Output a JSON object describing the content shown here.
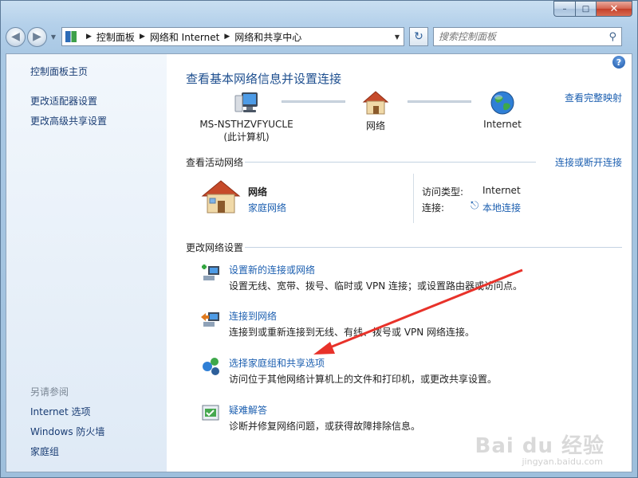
{
  "window": {
    "caption_buttons": {
      "minimize": "–",
      "maximize": "□",
      "close": "✕"
    }
  },
  "nav": {
    "back_icon": "back-arrow-icon",
    "forward_icon": "forward-arrow-icon",
    "breadcrumbs": [
      "控制面板",
      "网络和 Internet",
      "网络和共享中心"
    ],
    "search_placeholder": "搜索控制面板"
  },
  "sidebar": {
    "items": [
      {
        "label": "控制面板主页"
      },
      {
        "label": "更改适配器设置"
      },
      {
        "label": "更改高级共享设置"
      }
    ],
    "see_also_heading": "另请参阅",
    "see_also": [
      {
        "label": "Internet 选项"
      },
      {
        "label": "Windows 防火墙"
      },
      {
        "label": "家庭组"
      }
    ]
  },
  "main": {
    "title": "查看基本网络信息并设置连接",
    "full_map_link": "查看完整映射",
    "map": {
      "computer_name": "MS-NSTHZVFYUCLE",
      "computer_sub": "(此计算机)",
      "network_label": "网络",
      "internet_label": "Internet"
    },
    "active_networks": {
      "heading": "查看活动网络",
      "connect_link": "连接或断开连接",
      "network_name": "网络",
      "network_type_link": "家庭网络",
      "access_type_label": "访问类型:",
      "access_type_value": "Internet",
      "connections_label": "连接:",
      "connection_link": "本地连接"
    },
    "change_settings": {
      "heading": "更改网络设置",
      "options": [
        {
          "title": "设置新的连接或网络",
          "desc": "设置无线、宽带、拨号、临时或 VPN 连接；或设置路由器或访问点。",
          "icon": "new-connection-icon"
        },
        {
          "title": "连接到网络",
          "desc": "连接到或重新连接到无线、有线、拨号或 VPN 网络连接。",
          "icon": "connect-network-icon"
        },
        {
          "title": "选择家庭组和共享选项",
          "desc": "访问位于其他网络计算机上的文件和打印机，或更改共享设置。",
          "icon": "homegroup-icon"
        },
        {
          "title": "疑难解答",
          "desc": "诊断并修复网络问题，或获得故障排除信息。",
          "icon": "troubleshoot-icon"
        }
      ]
    }
  },
  "watermark": {
    "text": "Bai du 经验",
    "sub": "jingyan.baidu.com"
  },
  "colors": {
    "link": "#1c5fb0",
    "title": "#1e4f8f",
    "arrow": "#e8322a"
  }
}
